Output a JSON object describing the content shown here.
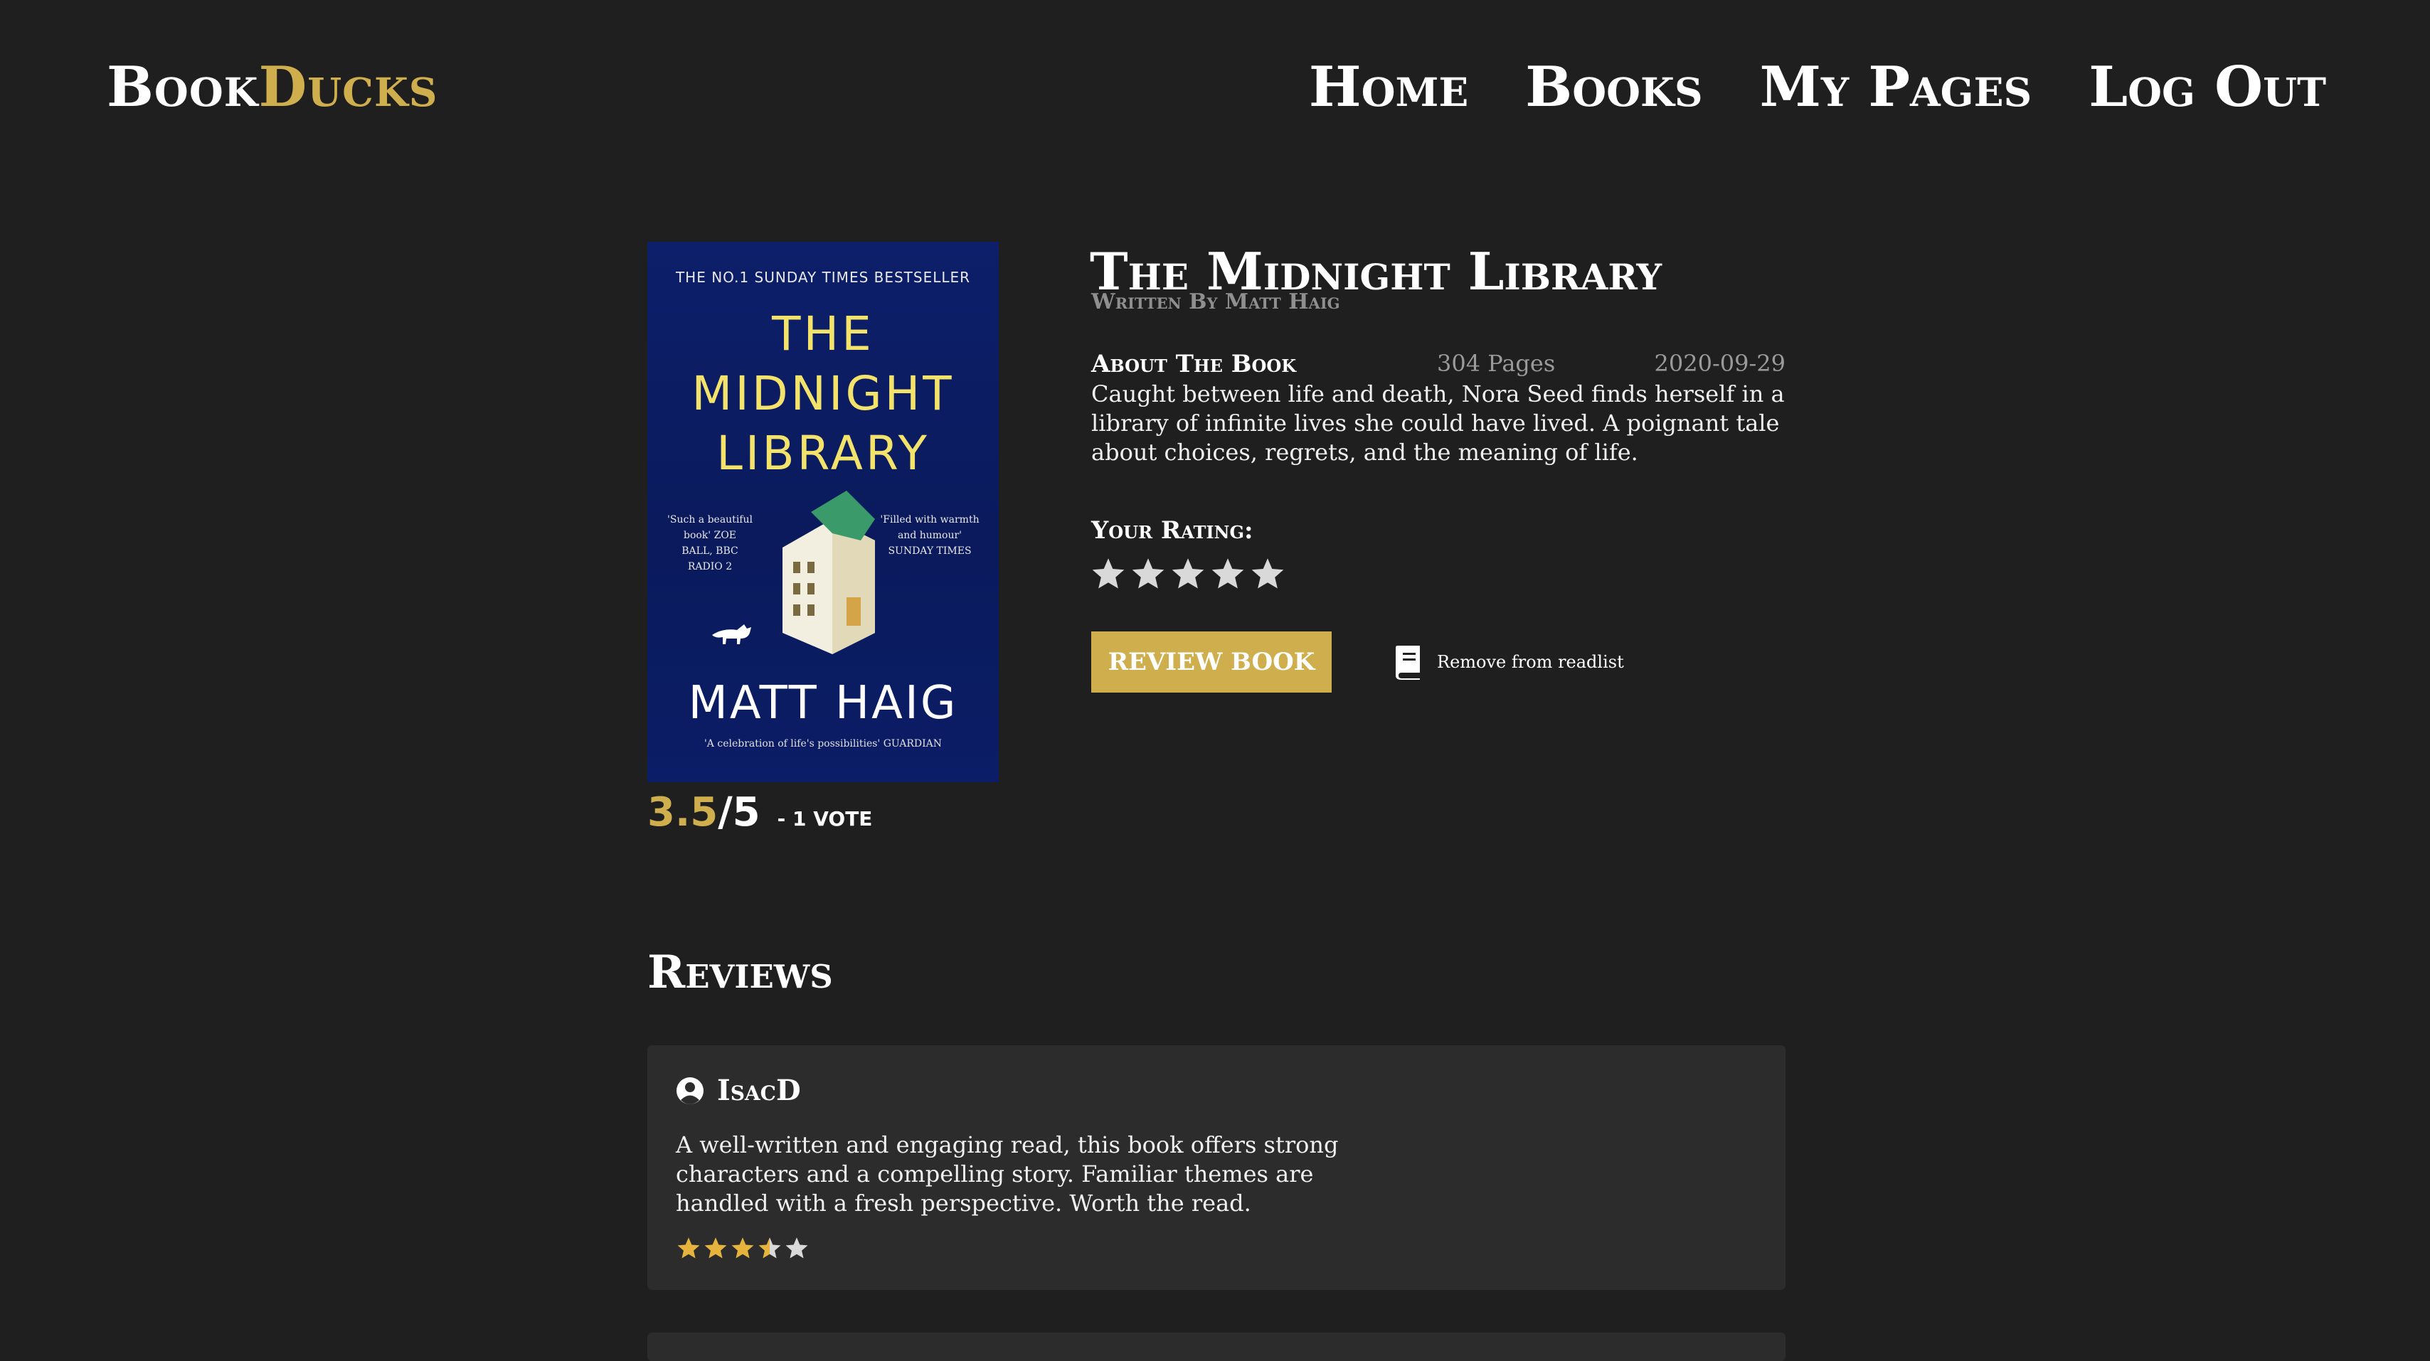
{
  "brand": {
    "part1": "Book",
    "part2": "Ducks",
    "accent_color": "#cfae4d"
  },
  "nav": {
    "home": "Home",
    "books": "Books",
    "my_pages": "My Pages",
    "log_out": "Log Out"
  },
  "cover": {
    "top_line": "THE NO.1 SUNDAY TIMES BESTSELLER",
    "title_line1": "THE",
    "title_line2": "MIDNIGHT",
    "title_line3": "LIBRARY",
    "quote_left": "'Such a beautiful book' ZOE BALL, BBC RADIO 2",
    "quote_right": "'Filled with warmth and humour' SUNDAY TIMES",
    "author": "MATT HAIG",
    "bottom_quote": "'A celebration of life's possibilities' GUARDIAN"
  },
  "rating_summary": {
    "score": "3.5",
    "out_of": "/5",
    "votes": "- 1 VOTE"
  },
  "book": {
    "title": "The Midnight Library",
    "byline": "Written By Matt Haig",
    "about_label": "About The Book",
    "pages": "304 Pages",
    "date": "2020-09-29",
    "description": "Caught between life and death, Nora Seed finds herself in a library of infinite lives she could have lived. A poignant tale about choices, regrets, and the meaning of life."
  },
  "your_rating": {
    "label": "Your Rating:",
    "value": 0,
    "max": 5
  },
  "actions": {
    "review_button": "REVIEW BOOK",
    "readlist_label": "Remove from readlist"
  },
  "reviews": {
    "heading": "Reviews",
    "items": [
      {
        "user": "IsacD",
        "text": "A well-written and engaging read, this book offers strong characters and a compelling story. Familiar themes are handled with a fresh perspective. Worth the read.",
        "rating": 3.5,
        "max": 5
      }
    ]
  },
  "icons": {
    "star": "star-icon",
    "user": "user-circle-icon",
    "book": "book-icon"
  }
}
